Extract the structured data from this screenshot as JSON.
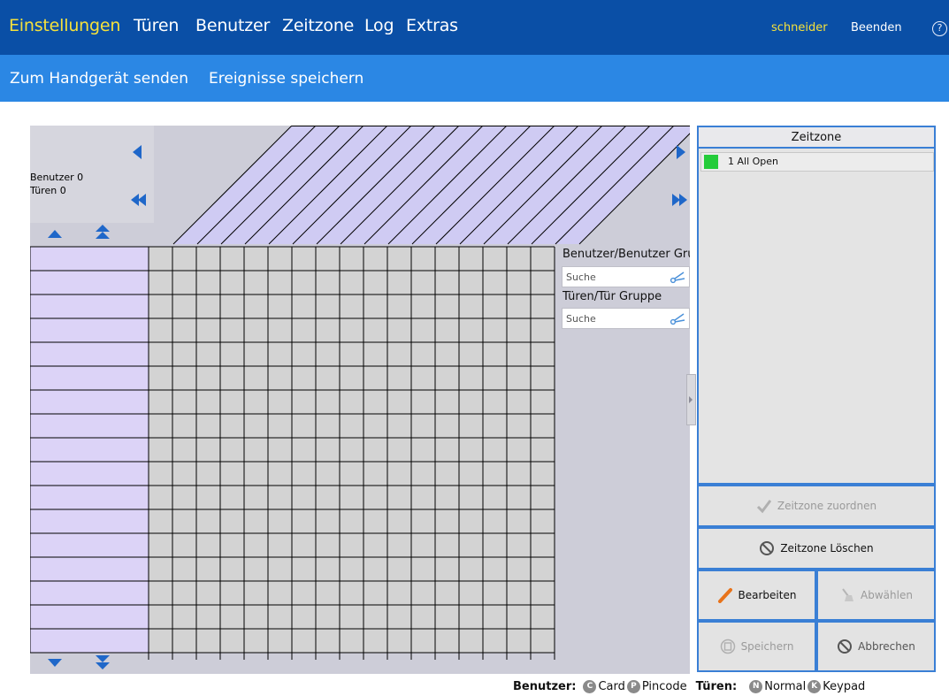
{
  "nav": {
    "items": [
      {
        "label": "Einstellungen",
        "active": true
      },
      {
        "label": "Türen",
        "active": false
      },
      {
        "label": "Benutzer",
        "active": false
      },
      {
        "label": "Zeitzone",
        "active": false
      },
      {
        "label": "Log",
        "active": false
      },
      {
        "label": "Extras",
        "active": false
      }
    ],
    "user": "schneider",
    "logout": "Beenden",
    "help_icon": "help-circle-icon"
  },
  "subnav": {
    "items": [
      {
        "label": "Zum Handgerät senden"
      },
      {
        "label": "Ereignisse speichern"
      }
    ]
  },
  "grid": {
    "users_info": "Benutzer 0",
    "doors_info": "Türen 0",
    "row_count": 17,
    "column_count": 17
  },
  "search": {
    "user_label": "Benutzer/Benutzer Gruppe",
    "user_placeholder": "Suche",
    "door_label": "Türen/Tür Gruppe",
    "door_placeholder": "Suche"
  },
  "zeitzone": {
    "header": "Zeitzone",
    "items": [
      {
        "label": "1 All Open",
        "color": "#24cc3a"
      }
    ]
  },
  "actions": {
    "assign": "Zeitzone zuordnen",
    "delete": "Zeitzone Löschen",
    "edit": "Bearbeiten",
    "deselect": "Abwählen",
    "save": "Speichern",
    "cancel": "Abbrechen"
  },
  "legend": {
    "users_title": "Benutzer:",
    "card_badge": "C",
    "card_label": "Card",
    "pin_badge": "P",
    "pin_label": "Pincode",
    "doors_title": "Türen:",
    "normal_badge": "N",
    "normal_label": "Normal",
    "keypad_badge": "K",
    "keypad_label": "Keypad"
  },
  "colors": {
    "nav_bg": "#0a4fa6",
    "subnav_bg": "#2b87e4",
    "active_nav": "#f5e13b",
    "row_header": "#dcd3f7",
    "diag_fill": "#cfcbf3",
    "cell_bg": "#d3d3d3",
    "panel_border": "#3a7fd5"
  }
}
